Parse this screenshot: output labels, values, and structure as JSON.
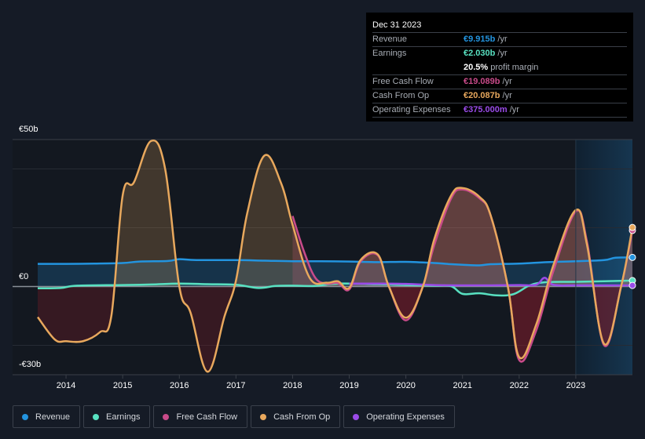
{
  "chart_data": {
    "type": "area",
    "title": "",
    "xlabel": "",
    "ylabel": "",
    "ylim": [
      -30,
      50
    ],
    "xlim": [
      2013.5,
      2024.0
    ],
    "currency": "€",
    "y_tick_labels": [
      {
        "value": 50,
        "label": "€50b"
      },
      {
        "value": 0,
        "label": "€0"
      },
      {
        "value": -30,
        "label": "-€30b"
      }
    ],
    "gridlines": [
      50,
      40,
      20,
      0,
      -20,
      -30
    ],
    "x_ticks": [
      2014,
      2015,
      2016,
      2017,
      2018,
      2019,
      2020,
      2021,
      2022,
      2023
    ],
    "highlight_range": [
      2023.0,
      2024.0
    ],
    "series": [
      {
        "name": "Revenue",
        "key": "revenue",
        "color": "#2394df",
        "points": [
          [
            2013.5,
            7.7
          ],
          [
            2014.0,
            7.7
          ],
          [
            2014.5,
            7.8
          ],
          [
            2015.0,
            8.0
          ],
          [
            2015.3,
            8.5
          ],
          [
            2015.8,
            8.7
          ],
          [
            2016.0,
            9.3
          ],
          [
            2016.3,
            9.0
          ],
          [
            2017.0,
            9.0
          ],
          [
            2017.5,
            8.8
          ],
          [
            2018.0,
            8.6
          ],
          [
            2018.5,
            8.6
          ],
          [
            2019.0,
            8.5
          ],
          [
            2019.5,
            8.3
          ],
          [
            2020.0,
            8.4
          ],
          [
            2020.5,
            8.0
          ],
          [
            2020.8,
            7.6
          ],
          [
            2021.0,
            7.4
          ],
          [
            2021.3,
            7.2
          ],
          [
            2021.5,
            7.6
          ],
          [
            2022.0,
            7.8
          ],
          [
            2022.5,
            8.3
          ],
          [
            2023.0,
            8.6
          ],
          [
            2023.5,
            9.0
          ],
          [
            2023.7,
            9.8
          ],
          [
            2024.0,
            9.915
          ]
        ]
      },
      {
        "name": "Earnings",
        "key": "earnings",
        "color": "#58e1c1",
        "points": [
          [
            2013.5,
            -0.6
          ],
          [
            2013.9,
            -0.5
          ],
          [
            2014.2,
            0.3
          ],
          [
            2015.0,
            0.5
          ],
          [
            2015.5,
            0.7
          ],
          [
            2016.0,
            1.0
          ],
          [
            2016.5,
            0.8
          ],
          [
            2017.0,
            0.6
          ],
          [
            2017.4,
            -0.5
          ],
          [
            2017.7,
            0.2
          ],
          [
            2018.0,
            0.3
          ],
          [
            2018.4,
            0.2
          ],
          [
            2018.8,
            1.0
          ],
          [
            2019.5,
            0.8
          ],
          [
            2020.0,
            0.5
          ],
          [
            2020.5,
            0.3
          ],
          [
            2020.8,
            0.1
          ],
          [
            2021.0,
            -2.5
          ],
          [
            2021.3,
            -2.3
          ],
          [
            2021.6,
            -3.0
          ],
          [
            2021.9,
            -2.6
          ],
          [
            2022.2,
            0.5
          ],
          [
            2022.5,
            1.5
          ],
          [
            2023.0,
            1.6
          ],
          [
            2023.5,
            1.8
          ],
          [
            2024.0,
            2.03
          ]
        ]
      },
      {
        "name": "Free Cash Flow",
        "key": "fcf",
        "color": "#c94b8a",
        "points": [
          [
            2018.0,
            24.0
          ],
          [
            2018.2,
            12.0
          ],
          [
            2018.4,
            3.0
          ],
          [
            2018.6,
            1.0
          ],
          [
            2018.8,
            1.2
          ],
          [
            2019.0,
            -1.0
          ],
          [
            2019.2,
            8.5
          ],
          [
            2019.5,
            10.7
          ],
          [
            2019.7,
            0
          ],
          [
            2020.0,
            -11.5
          ],
          [
            2020.3,
            0
          ],
          [
            2020.5,
            14.0
          ],
          [
            2020.8,
            30.0
          ],
          [
            2021.0,
            33.0
          ],
          [
            2021.3,
            30.0
          ],
          [
            2021.5,
            24.0
          ],
          [
            2021.8,
            0
          ],
          [
            2022.0,
            -25.0
          ],
          [
            2022.3,
            -15.0
          ],
          [
            2022.6,
            5.0
          ],
          [
            2023.0,
            25.5
          ],
          [
            2023.2,
            15.0
          ],
          [
            2023.5,
            -20.0
          ],
          [
            2023.8,
            0
          ],
          [
            2024.0,
            19.089
          ]
        ]
      },
      {
        "name": "Cash From Op",
        "key": "cfo",
        "color": "#e8a85d",
        "points": [
          [
            2013.5,
            -10.4
          ],
          [
            2013.8,
            -18.0
          ],
          [
            2014.0,
            -18.6
          ],
          [
            2014.3,
            -18.6
          ],
          [
            2014.6,
            -15.5
          ],
          [
            2014.8,
            -10.0
          ],
          [
            2015.0,
            31.0
          ],
          [
            2015.2,
            35.5
          ],
          [
            2015.5,
            49.5
          ],
          [
            2015.75,
            40.0
          ],
          [
            2016.0,
            0
          ],
          [
            2016.2,
            -9.0
          ],
          [
            2016.5,
            -29.0
          ],
          [
            2016.8,
            -10.0
          ],
          [
            2017.0,
            2.0
          ],
          [
            2017.2,
            25.0
          ],
          [
            2017.5,
            44.5
          ],
          [
            2017.8,
            35.0
          ],
          [
            2018.0,
            21.0
          ],
          [
            2018.3,
            3.0
          ],
          [
            2018.6,
            1.3
          ],
          [
            2018.8,
            1.8
          ],
          [
            2019.0,
            -0.5
          ],
          [
            2019.2,
            9.0
          ],
          [
            2019.5,
            11.0
          ],
          [
            2019.7,
            0
          ],
          [
            2020.0,
            -10.6
          ],
          [
            2020.3,
            0
          ],
          [
            2020.5,
            16.0
          ],
          [
            2020.8,
            31.0
          ],
          [
            2021.0,
            33.5
          ],
          [
            2021.3,
            30.5
          ],
          [
            2021.5,
            24.0
          ],
          [
            2021.8,
            0
          ],
          [
            2022.0,
            -24.0
          ],
          [
            2022.3,
            -13.0
          ],
          [
            2022.6,
            7.0
          ],
          [
            2023.0,
            26.0
          ],
          [
            2023.2,
            14.0
          ],
          [
            2023.5,
            -19.5
          ],
          [
            2023.8,
            0
          ],
          [
            2024.0,
            20.087
          ]
        ]
      },
      {
        "name": "Operating Expenses",
        "key": "opex",
        "color": "#9a4be8",
        "points": [
          [
            2019.0,
            1.0
          ],
          [
            2019.5,
            1.0
          ],
          [
            2020.0,
            0.9
          ],
          [
            2020.5,
            0.5
          ],
          [
            2021.0,
            0.4
          ],
          [
            2021.5,
            0.4
          ],
          [
            2022.0,
            0.5
          ],
          [
            2022.3,
            0.6
          ],
          [
            2022.45,
            3.0
          ],
          [
            2022.6,
            0.6
          ],
          [
            2023.0,
            0.4
          ],
          [
            2023.5,
            0.4
          ],
          [
            2024.0,
            0.375
          ]
        ]
      }
    ]
  },
  "tooltip": {
    "title": "Dec 31 2023",
    "rows": [
      {
        "label": "Revenue",
        "value": "€9.915b",
        "unit": " /yr",
        "color": "#2394df"
      },
      {
        "label": "Earnings",
        "value": "€2.030b",
        "unit": " /yr",
        "color": "#58e1c1"
      },
      {
        "label": "",
        "value": "20.5%",
        "unit": " profit margin",
        "color": "#ffffff"
      },
      {
        "label": "Free Cash Flow",
        "value": "€19.089b",
        "unit": " /yr",
        "color": "#c94b8a"
      },
      {
        "label": "Cash From Op",
        "value": "€20.087b",
        "unit": " /yr",
        "color": "#e8a85d"
      },
      {
        "label": "Operating Expenses",
        "value": "€375.000m",
        "unit": " /yr",
        "color": "#9a4be8"
      }
    ]
  },
  "legend": [
    {
      "label": "Revenue",
      "color": "#2394df"
    },
    {
      "label": "Earnings",
      "color": "#58e1c1"
    },
    {
      "label": "Free Cash Flow",
      "color": "#c94b8a"
    },
    {
      "label": "Cash From Op",
      "color": "#e8a85d"
    },
    {
      "label": "Operating Expenses",
      "color": "#9a4be8"
    }
  ]
}
